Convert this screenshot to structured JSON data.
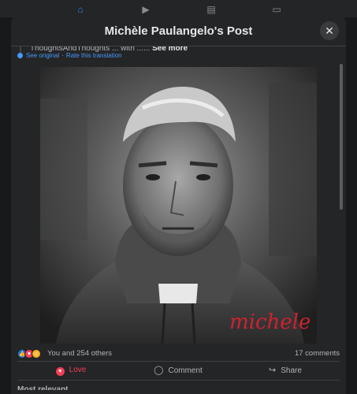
{
  "modal": {
    "title": "Michèle Paulangelo's Post",
    "close_icon": "close-icon"
  },
  "post": {
    "truncated_text": "ThoughtsAndThoughts ... with ...... ",
    "see_more_label": "See more",
    "see_original_label": "See original",
    "separator": "·",
    "rate_translation_label": "Rate this translation",
    "photo_signature": "michele"
  },
  "reactions": {
    "icons": [
      "like-icon",
      "love-icon",
      "care-icon"
    ],
    "summary": "You and 254 others",
    "comments": "17 comments"
  },
  "actions": {
    "love_label": "Love",
    "comment_label": "Comment",
    "share_label": "Share"
  },
  "comments_section": {
    "sort_label": "Most relevant"
  },
  "colors": {
    "background": "#18191a",
    "surface": "#242526",
    "love": "#f33e58",
    "link": "#4599ff"
  }
}
